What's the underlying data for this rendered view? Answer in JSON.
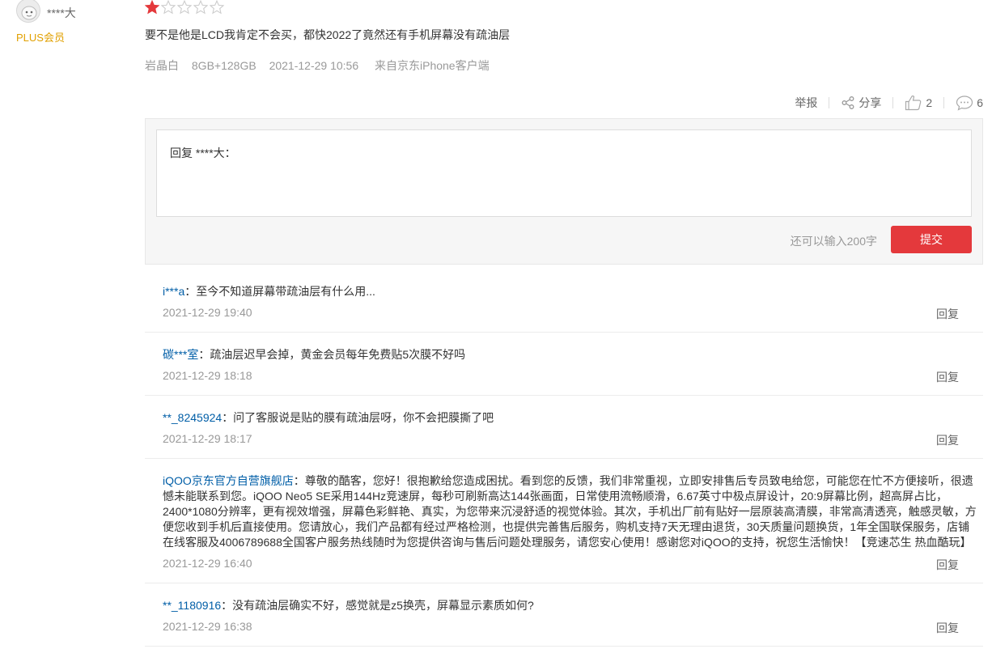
{
  "user": {
    "name": "****大",
    "badge": "PLUS会员"
  },
  "review": {
    "rating": 1,
    "rating_max": 5,
    "content": "要不是他是LCD我肯定不会买，都快2022了竟然还有手机屏幕没有疏油层",
    "color": "岩晶白",
    "spec": "8GB+128GB",
    "time": "2021-12-29 10:56",
    "source": "来自京东iPhone客户端"
  },
  "actions": {
    "report": "举报",
    "share": "分享",
    "likes": "2",
    "comments": "6"
  },
  "reply_form": {
    "prefill": "回复 ****大：",
    "remaining": "还可以输入200字",
    "submit": "提交"
  },
  "replies": [
    {
      "name": "i***a",
      "text": "：至今不知道屏幕带疏油层有什么用...",
      "time": "2021-12-29 19:40",
      "action": "回复"
    },
    {
      "name": "碳***室",
      "text": "：疏油层迟早会掉，黄金会员每年免费贴5次膜不好吗",
      "time": "2021-12-29 18:18",
      "action": "回复"
    },
    {
      "name": "**_8245924",
      "text": "：问了客服说是贴的膜有疏油层呀，你不会把膜撕了吧",
      "time": "2021-12-29 18:17",
      "action": "回复"
    },
    {
      "name": "iQOO京东官方自营旗舰店",
      "text": "：尊敬的酷客，您好！很抱歉给您造成困扰。看到您的反馈，我们非常重视，立即安排售后专员致电给您，可能您在忙不方便接听，很遗憾未能联系到您。iQOO Neo5 SE采用144Hz竞速屏，每秒可刷新高达144张画面，日常使用流畅顺滑，6.67英寸中极点屏设计，20:9屏幕比例，超高屏占比，2400*1080分辨率，更有视效增强，屏幕色彩鲜艳、真实，为您带来沉浸舒适的视觉体验。其次，手机出厂前有贴好一层原装高清膜，非常高清透亮，触感灵敏，方便您收到手机后直接使用。您请放心，我们产品都有经过严格检测，也提供完善售后服务，购机支持7天无理由退货，30天质量问题换货，1年全国联保服务，店铺在线客服及4006789688全国客户服务热线随时为您提供咨询与售后问题处理服务，请您安心使用！感谢您对iQOO的支持，祝您生活愉快！【竞速芯生 热血酷玩】",
      "time": "2021-12-29 16:40",
      "action": "回复"
    },
    {
      "name": "**_1180916",
      "text": "：没有疏油层确实不好，感觉就是z5换壳，屏幕显示素质如何?",
      "time": "2021-12-29 16:38",
      "action": "回复"
    }
  ],
  "colors": {
    "accent": "#e4393c",
    "link": "#005ea7",
    "plus": "#e1a000",
    "star_on": "#e4393c",
    "star_off": "#cccccc"
  }
}
